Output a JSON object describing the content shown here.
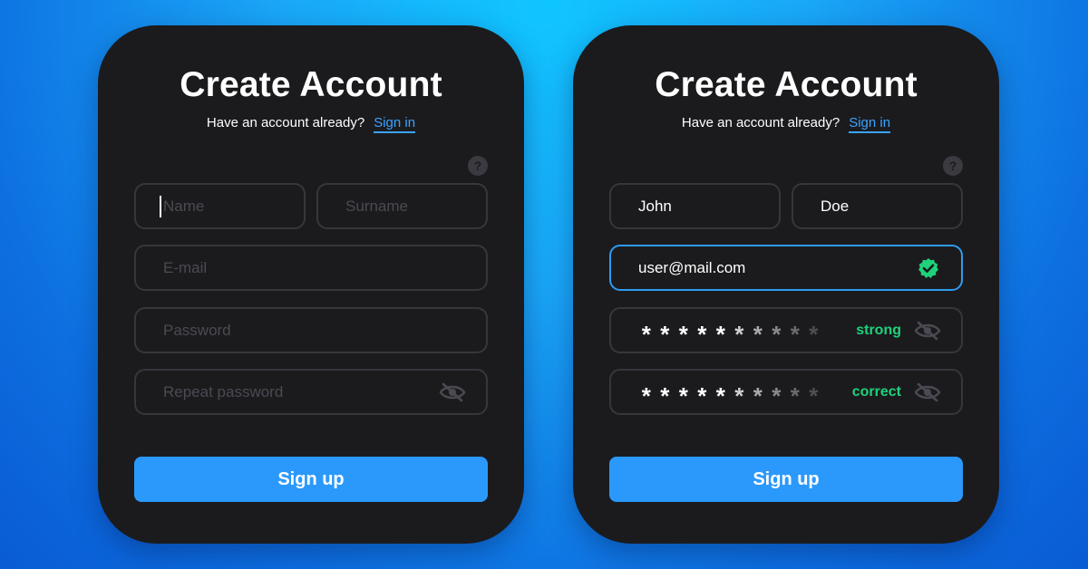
{
  "colors": {
    "card_bg": "#1b1b1e",
    "accent": "#2b99fb",
    "link": "#3ba3ff",
    "success": "#1fd17a",
    "field_border": "#36363d",
    "placeholder": "#4a4a52"
  },
  "left_card": {
    "title": "Create Account",
    "subtitle_text": "Have an account already?",
    "signin_link": "Sign in",
    "help_icon": "?",
    "name_placeholder": "Name",
    "surname_placeholder": "Surname",
    "email_placeholder": "E-mail",
    "password_placeholder": "Password",
    "repeat_placeholder": "Repeat password",
    "signup_label": "Sign up",
    "icons": [
      "help-icon",
      "eye-slash-icon"
    ]
  },
  "right_card": {
    "title": "Create Account",
    "subtitle_text": "Have an account already?",
    "signin_link": "Sign in",
    "help_icon": "?",
    "name_value": "John",
    "surname_value": "Doe",
    "email_value": "user@mail.com",
    "password_strength": "strong",
    "repeat_status": "correct",
    "signup_label": "Sign up",
    "icons": [
      "help-icon",
      "check-circle-icon",
      "eye-slash-icon"
    ]
  }
}
